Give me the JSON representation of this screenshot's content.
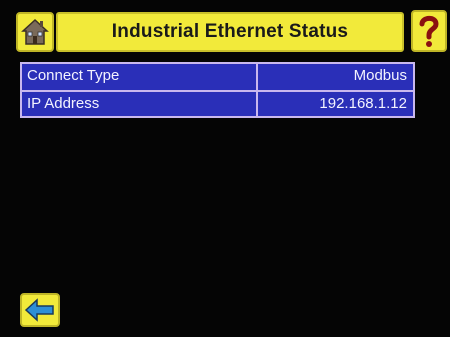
{
  "header": {
    "title": "Industrial Ethernet Status"
  },
  "status_rows": [
    {
      "label": "Connect Type",
      "value": "Modbus"
    },
    {
      "label": "IP Address",
      "value": "192.168.1.12"
    }
  ],
  "icons": {
    "home": "home-icon",
    "help": "help-question-icon",
    "back": "back-arrow-icon"
  },
  "colors": {
    "header_bg": "#f2ea3a",
    "table_cell_bg": "#2a2fb8",
    "table_border": "#c9b8ee",
    "screen_bg": "#050505"
  }
}
